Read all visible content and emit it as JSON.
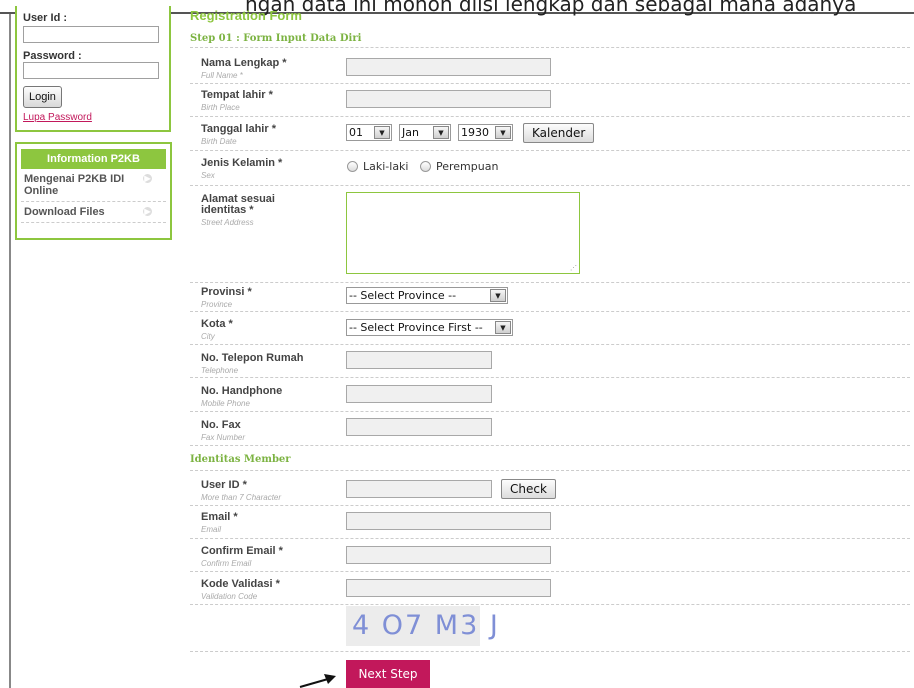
{
  "top_caption": "ngan data ini mohon diisi lengkap dan sebagai mana adanya",
  "login": {
    "userid_label": "User Id :",
    "password_label": "Password :",
    "login_button": "Login",
    "forgot_link": "Lupa Password"
  },
  "info": {
    "title": "Information P2KB",
    "items": [
      "Mengenai P2KB IDI Online",
      "Download Files"
    ]
  },
  "form": {
    "title": "Registration Form",
    "step1_title": "Step 01 : Form Input Data Diri",
    "fields": {
      "nama": {
        "label": "Nama Lengkap *",
        "sub": "Full Name *"
      },
      "tempat": {
        "label": "Tempat lahir *",
        "sub": "Birth Place"
      },
      "tanggal": {
        "label": "Tanggal lahir *",
        "sub": "Birth Date"
      },
      "gender": {
        "label": "Jenis Kelamin *",
        "sub": "Sex"
      },
      "alamat": {
        "label": "Alamat sesuai identitas *",
        "sub": "Street Address"
      },
      "provinsi": {
        "label": "Provinsi *",
        "sub": "Province"
      },
      "kota": {
        "label": "Kota *",
        "sub": "City"
      },
      "telepon": {
        "label": "No. Telepon Rumah",
        "sub": "Telephone"
      },
      "handphone": {
        "label": "No. Handphone",
        "sub": "Mobile Phone"
      },
      "fax": {
        "label": "No. Fax",
        "sub": "Fax Number"
      }
    },
    "birth": {
      "day": "01",
      "month": "Jan",
      "year": "1930",
      "calendar_button": "Kalender"
    },
    "gender_options": [
      "Laki-laki",
      "Perempuan"
    ],
    "province_select": "-- Select Province --",
    "city_select": "-- Select Province First --",
    "member_title": "Identitas Member",
    "member_fields": {
      "userid": {
        "label": "User ID *",
        "sub": "More than 7 Character"
      },
      "email": {
        "label": "Email *",
        "sub": "Email"
      },
      "confirm": {
        "label": "Confirm Email *",
        "sub": "Confirm Email"
      },
      "kode": {
        "label": "Kode Validasi *",
        "sub": "Validation Code"
      }
    },
    "check_button": "Check",
    "captcha_text": "4 O7 M3 J",
    "next_button": "Next Step"
  }
}
